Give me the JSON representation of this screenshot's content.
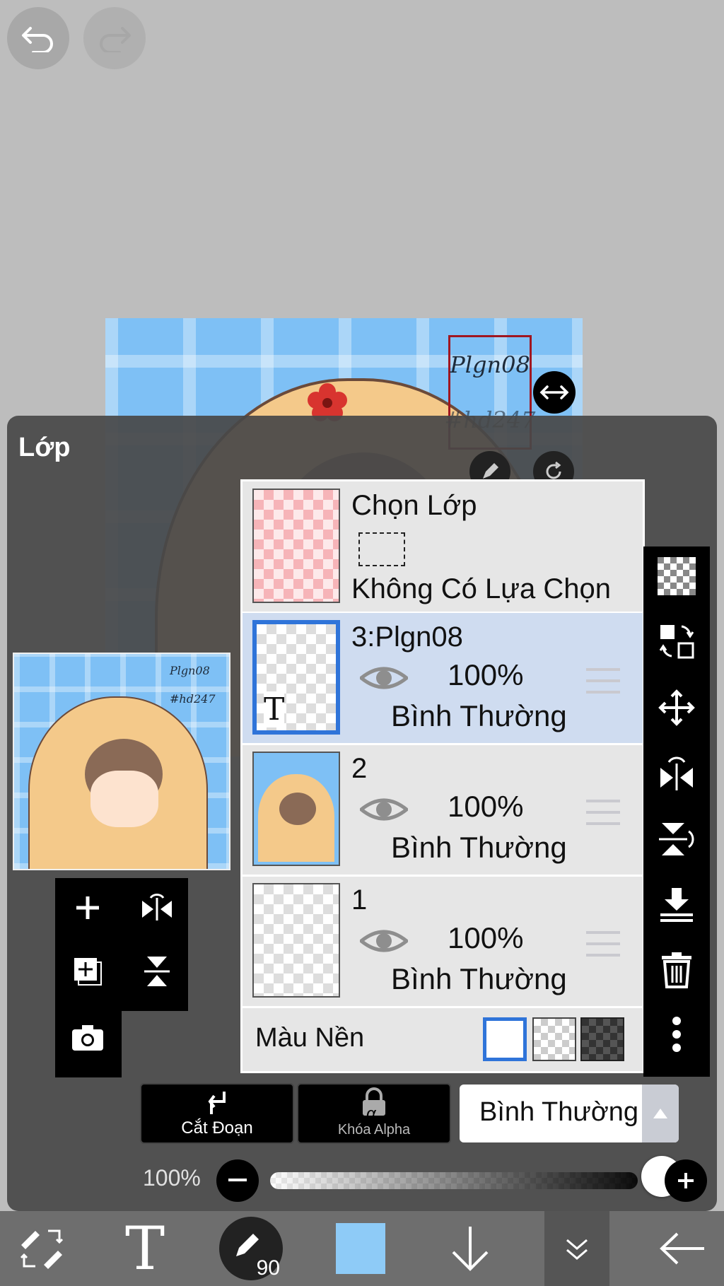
{
  "top_controls": {
    "undo_icon": "undo-icon",
    "redo_icon": "redo-icon"
  },
  "canvas": {
    "selection_line1": "Plgn08",
    "selection_line2": "#hd247"
  },
  "panel": {
    "title": "Lớp",
    "preview_text1": "Plgn08",
    "preview_text2": "#hd247"
  },
  "selection_layer": {
    "title": "Chọn Lớp",
    "status": "Không Có Lựa Chọn"
  },
  "layers": [
    {
      "name": "3:Plgn08",
      "opacity": "100%",
      "blend": "Bình Thường",
      "selected": true,
      "thumb_text_icon": "T"
    },
    {
      "name": "2",
      "opacity": "100%",
      "blend": "Bình Thường",
      "selected": false
    },
    {
      "name": "1",
      "opacity": "100%",
      "blend": "Bình Thường",
      "selected": false
    }
  ],
  "background": {
    "label": "Màu Nền",
    "options": [
      "white",
      "transparent",
      "dark"
    ],
    "selected": "white"
  },
  "actions": {
    "clip_label": "Cắt Đoạn",
    "alpha_lock_label": "Khóa Alpha",
    "alpha_symbol": "α",
    "blend_mode": "Bình Thường"
  },
  "opacity": {
    "label": "100%",
    "value": 1.0
  },
  "toolbar": {
    "brush_size": "90",
    "text_tool": "T",
    "current_color": "#8ecbf7"
  },
  "colors": {
    "accent": "#2f74d9",
    "selection_red": "#a01620",
    "panel": "#484848"
  }
}
